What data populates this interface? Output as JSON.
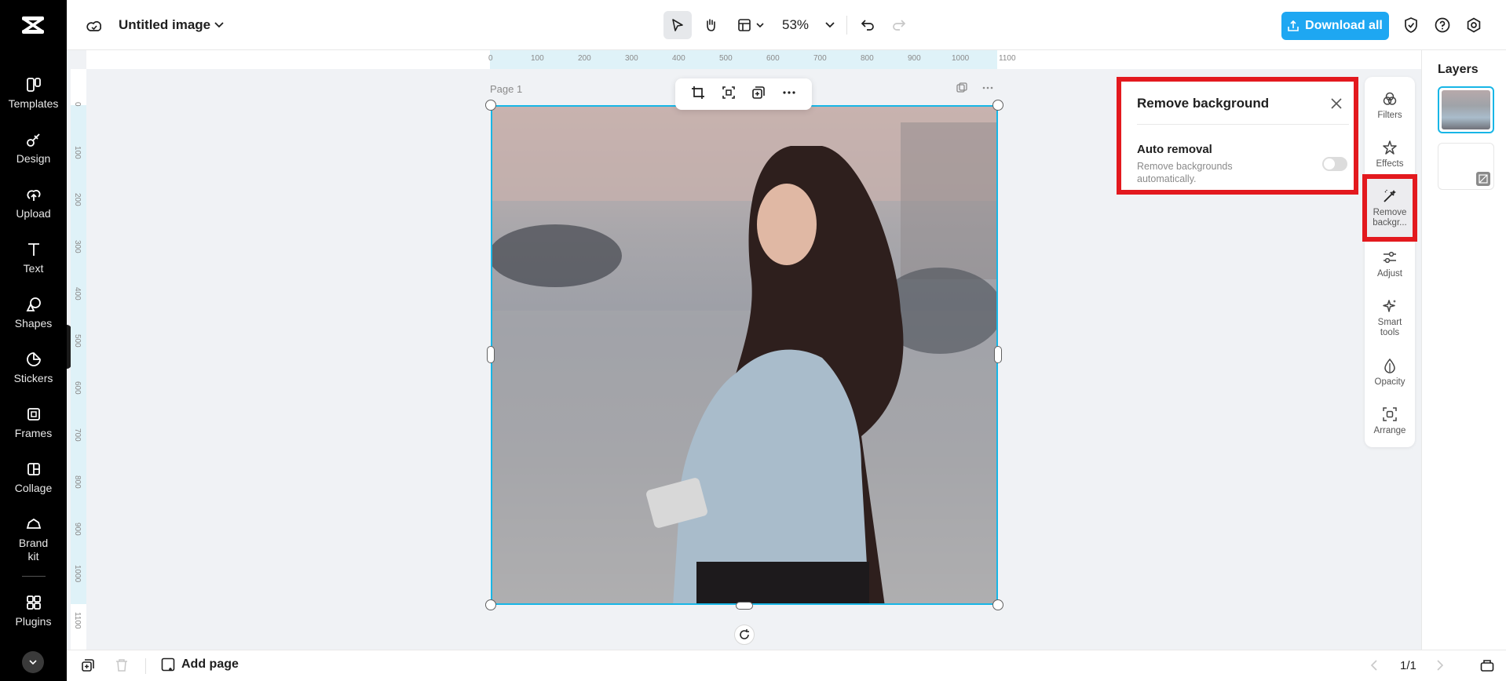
{
  "topbar": {
    "title": "Untitled image",
    "zoom": "53%",
    "download_label": "Download all"
  },
  "leftnav": {
    "items": [
      {
        "label": "Templates",
        "icon": "templates-icon"
      },
      {
        "label": "Design",
        "icon": "design-icon"
      },
      {
        "label": "Upload",
        "icon": "upload-icon"
      },
      {
        "label": "Text",
        "icon": "text-icon"
      },
      {
        "label": "Shapes",
        "icon": "shapes-icon"
      },
      {
        "label": "Stickers",
        "icon": "stickers-icon"
      },
      {
        "label": "Frames",
        "icon": "frames-icon"
      },
      {
        "label": "Collage",
        "icon": "collage-icon"
      },
      {
        "label": "Brand\nkit",
        "icon": "brand-kit-icon"
      },
      {
        "label": "Plugins",
        "icon": "plugins-icon"
      }
    ]
  },
  "canvas": {
    "page_label": "Page 1"
  },
  "ruler": {
    "h_ticks": [
      "0",
      "100",
      "200",
      "300",
      "400",
      "500",
      "600",
      "700",
      "800",
      "900",
      "1000",
      "1100"
    ],
    "v_ticks": [
      "0",
      "100",
      "200",
      "300",
      "400",
      "500",
      "600",
      "700",
      "800",
      "900",
      "1000",
      "1100"
    ]
  },
  "remove_bg_panel": {
    "title": "Remove background",
    "option_title": "Auto removal",
    "option_desc": "Remove backgrounds automatically.",
    "toggle_on": false
  },
  "tools": [
    {
      "label": "Filters",
      "icon": "filters-icon"
    },
    {
      "label": "Effects",
      "icon": "effects-icon"
    },
    {
      "label": "Remove backgr...",
      "icon": "remove-background-icon"
    },
    {
      "label": "Adjust",
      "icon": "adjust-icon"
    },
    {
      "label": "Smart tools",
      "icon": "smart-tools-icon"
    },
    {
      "label": "Opacity",
      "icon": "opacity-icon"
    },
    {
      "label": "Arrange",
      "icon": "arrange-icon"
    }
  ],
  "layers": {
    "title": "Layers"
  },
  "bottombar": {
    "add_page": "Add page",
    "page_counter": "1/1"
  },
  "colors": {
    "accent": "#1ea7f2",
    "highlight": "#e3191e",
    "selection": "#18b6e6"
  }
}
